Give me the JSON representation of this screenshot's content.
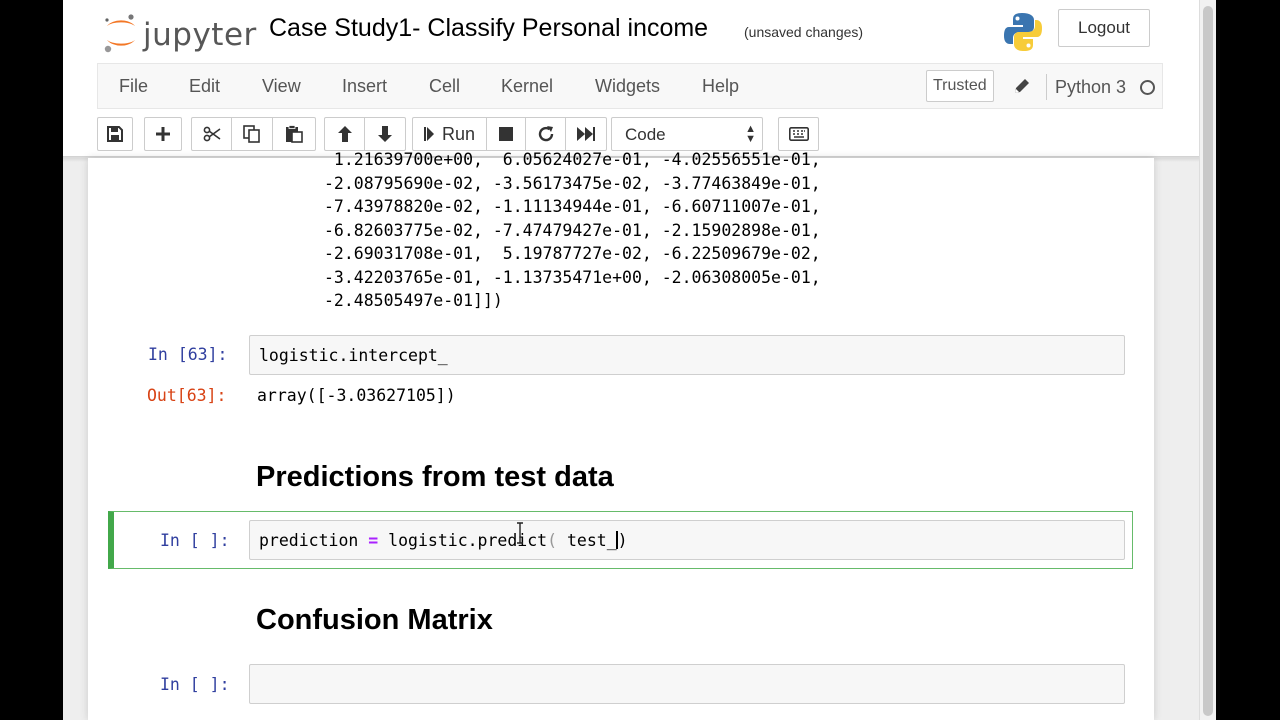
{
  "header": {
    "logo_text": "jupyter",
    "notebook_title": "Case Study1- Classify Personal income",
    "save_status": "(unsaved changes)",
    "logout_label": "Logout"
  },
  "menu": {
    "items": [
      "File",
      "Edit",
      "View",
      "Insert",
      "Cell",
      "Kernel",
      "Widgets",
      "Help"
    ],
    "trusted_label": "Trusted",
    "kernel_name": "Python 3"
  },
  "toolbar": {
    "run_label": "Run",
    "cell_type": "Code"
  },
  "cells": {
    "array_output_lines": [
      " 1.21639700e+00,  6.05624027e-01, -4.02556551e-01,",
      "-2.08795690e-02, -3.56173475e-02, -3.77463849e-01,",
      "-7.43978820e-02, -1.11134944e-01, -6.60711007e-01,",
      "-6.82603775e-02, -7.47479427e-01, -2.15902898e-01,",
      "-2.69031708e-01,  5.19787727e-02, -6.22509679e-02,",
      "-3.42203765e-01, -1.13735471e+00, -2.06308005e-01,",
      "-2.48505497e-01]])"
    ],
    "cell63_in_prompt": "In [63]:",
    "cell63_code": "logistic.intercept_",
    "cell63_out_prompt": "Out[63]:",
    "cell63_output": "array([-3.03627105])",
    "heading_predictions": "Predictions from test data",
    "prediction_prompt": "In [ ]:",
    "prediction_code": {
      "lhs": "prediction ",
      "op": "=",
      "call": " logistic.predict",
      "open": "(",
      "arg": " test_",
      "close": ")"
    },
    "heading_confusion": "Confusion Matrix",
    "empty_prompt": "In [ ]:"
  }
}
